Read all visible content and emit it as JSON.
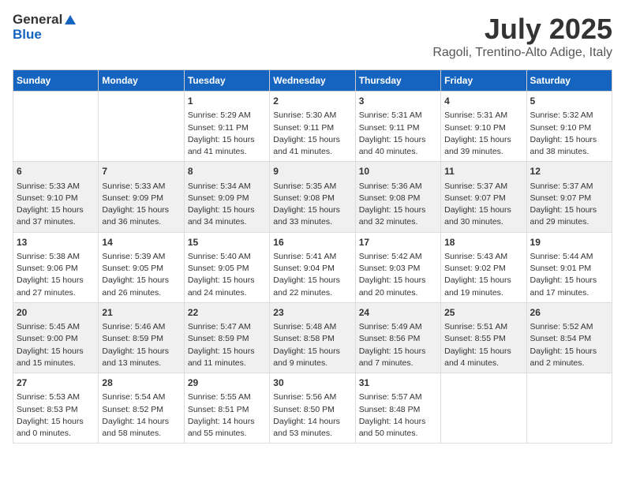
{
  "header": {
    "logo_line1": "General",
    "logo_line2": "Blue",
    "title": "July 2025",
    "subtitle": "Ragoli, Trentino-Alto Adige, Italy"
  },
  "days_of_week": [
    "Sunday",
    "Monday",
    "Tuesday",
    "Wednesday",
    "Thursday",
    "Friday",
    "Saturday"
  ],
  "weeks": [
    [
      {
        "day": "",
        "sunrise": "",
        "sunset": "",
        "daylight": ""
      },
      {
        "day": "",
        "sunrise": "",
        "sunset": "",
        "daylight": ""
      },
      {
        "day": "1",
        "sunrise": "Sunrise: 5:29 AM",
        "sunset": "Sunset: 9:11 PM",
        "daylight": "Daylight: 15 hours and 41 minutes."
      },
      {
        "day": "2",
        "sunrise": "Sunrise: 5:30 AM",
        "sunset": "Sunset: 9:11 PM",
        "daylight": "Daylight: 15 hours and 41 minutes."
      },
      {
        "day": "3",
        "sunrise": "Sunrise: 5:31 AM",
        "sunset": "Sunset: 9:11 PM",
        "daylight": "Daylight: 15 hours and 40 minutes."
      },
      {
        "day": "4",
        "sunrise": "Sunrise: 5:31 AM",
        "sunset": "Sunset: 9:10 PM",
        "daylight": "Daylight: 15 hours and 39 minutes."
      },
      {
        "day": "5",
        "sunrise": "Sunrise: 5:32 AM",
        "sunset": "Sunset: 9:10 PM",
        "daylight": "Daylight: 15 hours and 38 minutes."
      }
    ],
    [
      {
        "day": "6",
        "sunrise": "Sunrise: 5:33 AM",
        "sunset": "Sunset: 9:10 PM",
        "daylight": "Daylight: 15 hours and 37 minutes."
      },
      {
        "day": "7",
        "sunrise": "Sunrise: 5:33 AM",
        "sunset": "Sunset: 9:09 PM",
        "daylight": "Daylight: 15 hours and 36 minutes."
      },
      {
        "day": "8",
        "sunrise": "Sunrise: 5:34 AM",
        "sunset": "Sunset: 9:09 PM",
        "daylight": "Daylight: 15 hours and 34 minutes."
      },
      {
        "day": "9",
        "sunrise": "Sunrise: 5:35 AM",
        "sunset": "Sunset: 9:08 PM",
        "daylight": "Daylight: 15 hours and 33 minutes."
      },
      {
        "day": "10",
        "sunrise": "Sunrise: 5:36 AM",
        "sunset": "Sunset: 9:08 PM",
        "daylight": "Daylight: 15 hours and 32 minutes."
      },
      {
        "day": "11",
        "sunrise": "Sunrise: 5:37 AM",
        "sunset": "Sunset: 9:07 PM",
        "daylight": "Daylight: 15 hours and 30 minutes."
      },
      {
        "day": "12",
        "sunrise": "Sunrise: 5:37 AM",
        "sunset": "Sunset: 9:07 PM",
        "daylight": "Daylight: 15 hours and 29 minutes."
      }
    ],
    [
      {
        "day": "13",
        "sunrise": "Sunrise: 5:38 AM",
        "sunset": "Sunset: 9:06 PM",
        "daylight": "Daylight: 15 hours and 27 minutes."
      },
      {
        "day": "14",
        "sunrise": "Sunrise: 5:39 AM",
        "sunset": "Sunset: 9:05 PM",
        "daylight": "Daylight: 15 hours and 26 minutes."
      },
      {
        "day": "15",
        "sunrise": "Sunrise: 5:40 AM",
        "sunset": "Sunset: 9:05 PM",
        "daylight": "Daylight: 15 hours and 24 minutes."
      },
      {
        "day": "16",
        "sunrise": "Sunrise: 5:41 AM",
        "sunset": "Sunset: 9:04 PM",
        "daylight": "Daylight: 15 hours and 22 minutes."
      },
      {
        "day": "17",
        "sunrise": "Sunrise: 5:42 AM",
        "sunset": "Sunset: 9:03 PM",
        "daylight": "Daylight: 15 hours and 20 minutes."
      },
      {
        "day": "18",
        "sunrise": "Sunrise: 5:43 AM",
        "sunset": "Sunset: 9:02 PM",
        "daylight": "Daylight: 15 hours and 19 minutes."
      },
      {
        "day": "19",
        "sunrise": "Sunrise: 5:44 AM",
        "sunset": "Sunset: 9:01 PM",
        "daylight": "Daylight: 15 hours and 17 minutes."
      }
    ],
    [
      {
        "day": "20",
        "sunrise": "Sunrise: 5:45 AM",
        "sunset": "Sunset: 9:00 PM",
        "daylight": "Daylight: 15 hours and 15 minutes."
      },
      {
        "day": "21",
        "sunrise": "Sunrise: 5:46 AM",
        "sunset": "Sunset: 8:59 PM",
        "daylight": "Daylight: 15 hours and 13 minutes."
      },
      {
        "day": "22",
        "sunrise": "Sunrise: 5:47 AM",
        "sunset": "Sunset: 8:59 PM",
        "daylight": "Daylight: 15 hours and 11 minutes."
      },
      {
        "day": "23",
        "sunrise": "Sunrise: 5:48 AM",
        "sunset": "Sunset: 8:58 PM",
        "daylight": "Daylight: 15 hours and 9 minutes."
      },
      {
        "day": "24",
        "sunrise": "Sunrise: 5:49 AM",
        "sunset": "Sunset: 8:56 PM",
        "daylight": "Daylight: 15 hours and 7 minutes."
      },
      {
        "day": "25",
        "sunrise": "Sunrise: 5:51 AM",
        "sunset": "Sunset: 8:55 PM",
        "daylight": "Daylight: 15 hours and 4 minutes."
      },
      {
        "day": "26",
        "sunrise": "Sunrise: 5:52 AM",
        "sunset": "Sunset: 8:54 PM",
        "daylight": "Daylight: 15 hours and 2 minutes."
      }
    ],
    [
      {
        "day": "27",
        "sunrise": "Sunrise: 5:53 AM",
        "sunset": "Sunset: 8:53 PM",
        "daylight": "Daylight: 15 hours and 0 minutes."
      },
      {
        "day": "28",
        "sunrise": "Sunrise: 5:54 AM",
        "sunset": "Sunset: 8:52 PM",
        "daylight": "Daylight: 14 hours and 58 minutes."
      },
      {
        "day": "29",
        "sunrise": "Sunrise: 5:55 AM",
        "sunset": "Sunset: 8:51 PM",
        "daylight": "Daylight: 14 hours and 55 minutes."
      },
      {
        "day": "30",
        "sunrise": "Sunrise: 5:56 AM",
        "sunset": "Sunset: 8:50 PM",
        "daylight": "Daylight: 14 hours and 53 minutes."
      },
      {
        "day": "31",
        "sunrise": "Sunrise: 5:57 AM",
        "sunset": "Sunset: 8:48 PM",
        "daylight": "Daylight: 14 hours and 50 minutes."
      },
      {
        "day": "",
        "sunrise": "",
        "sunset": "",
        "daylight": ""
      },
      {
        "day": "",
        "sunrise": "",
        "sunset": "",
        "daylight": ""
      }
    ]
  ]
}
